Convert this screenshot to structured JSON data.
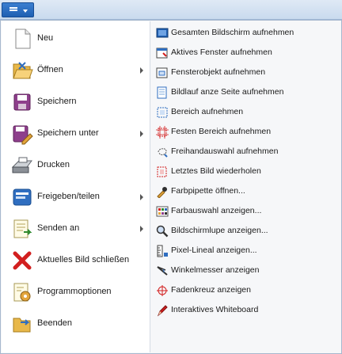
{
  "app_menu": {
    "button_icon": "menu-icon"
  },
  "left_menu": [
    {
      "label": "Neu",
      "icon": "new-document-icon",
      "submenu": false
    },
    {
      "label": "Öffnen",
      "icon": "open-folder-icon",
      "submenu": true
    },
    {
      "label": "Speichern",
      "icon": "save-icon",
      "submenu": false
    },
    {
      "label": "Speichern unter",
      "icon": "save-as-icon",
      "submenu": true
    },
    {
      "label": "Drucken",
      "icon": "printer-icon",
      "submenu": false
    },
    {
      "label": "Freigeben/teilen",
      "icon": "share-icon",
      "submenu": true
    },
    {
      "label": "Senden an",
      "icon": "send-to-icon",
      "submenu": true
    },
    {
      "label": "Aktuelles Bild schließen",
      "icon": "close-icon",
      "submenu": false
    },
    {
      "label": "Programmoptionen",
      "icon": "options-icon",
      "submenu": false
    },
    {
      "label": "Beenden",
      "icon": "exit-icon",
      "submenu": false
    }
  ],
  "right_menu": [
    {
      "label": "Gesamten Bildschirm aufnehmen",
      "icon": "fullscreen-capture-icon"
    },
    {
      "label": "Aktives Fenster aufnehmen",
      "icon": "active-window-icon"
    },
    {
      "label": "Fensterobjekt aufnehmen",
      "icon": "window-object-icon"
    },
    {
      "label": "Bildlauf anze Seite aufnehmen",
      "icon": "scroll-capture-icon"
    },
    {
      "label": "Bereich aufnehmen",
      "icon": "region-capture-icon"
    },
    {
      "label": "Festen Bereich aufnehmen",
      "icon": "fixed-region-icon"
    },
    {
      "label": "Freihandauswahl aufnehmen",
      "icon": "freehand-icon"
    },
    {
      "label": "Letztes Bild wiederholen",
      "icon": "repeat-last-icon"
    },
    {
      "label": "Farbpipette öffnen...",
      "icon": "color-picker-icon"
    },
    {
      "label": "Farbauswahl anzeigen...",
      "icon": "color-palette-icon"
    },
    {
      "label": "Bildschirmlupe anzeigen...",
      "icon": "magnifier-icon"
    },
    {
      "label": "Pixel-Lineal anzeigen...",
      "icon": "ruler-icon"
    },
    {
      "label": "Winkelmesser anzeigen",
      "icon": "protractor-icon"
    },
    {
      "label": "Fadenkreuz anzeigen",
      "icon": "crosshair-icon"
    },
    {
      "label": "Interaktives Whiteboard",
      "icon": "whiteboard-icon"
    }
  ]
}
